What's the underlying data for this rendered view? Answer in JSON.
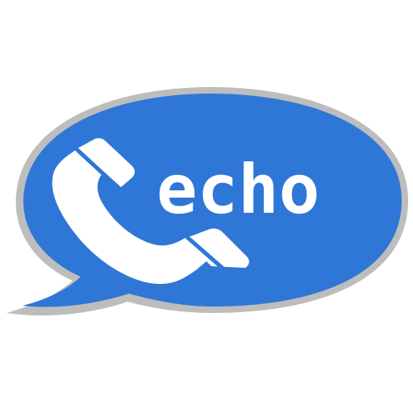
{
  "logo": {
    "wordmark": "echo",
    "bubble_color": "#2F77D6",
    "outline_color": "#BDBDBD",
    "foreground_color": "#FFFFFF",
    "icon": "phone-handset-icon"
  }
}
